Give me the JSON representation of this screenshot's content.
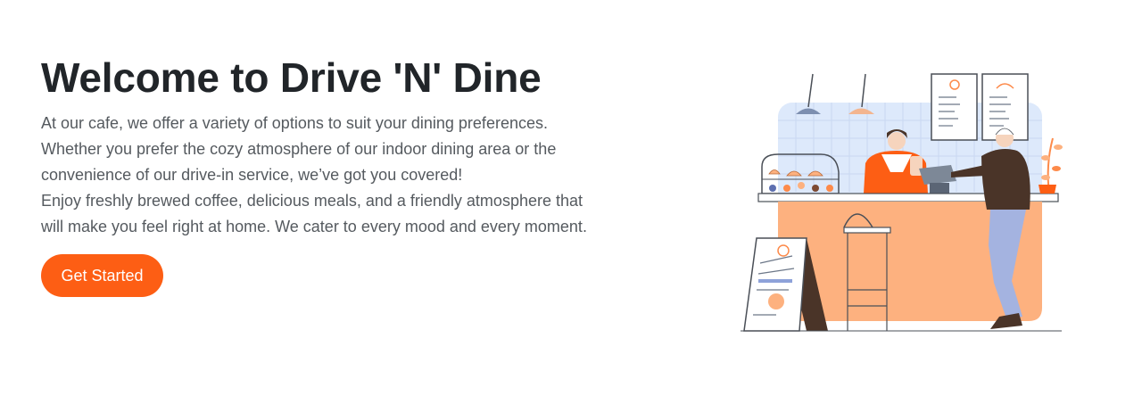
{
  "hero": {
    "title": "Welcome to Drive 'N' Dine",
    "paragraph_lines": [
      "At our cafe, we offer a variety of options to suit your dining preferences.",
      "Whether you prefer the cozy atmosphere of our indoor dining area or the",
      "convenience of our drive-in service, we’ve got you covered!",
      "Enjoy freshly brewed coffee, delicious meals, and a friendly atmosphere that",
      "will make you feel right at home. We cater to every mood and every moment."
    ],
    "cta_label": "Get Started"
  },
  "colors": {
    "accent": "#fd5e14",
    "heading": "#212529",
    "body_text": "#555a5f",
    "counter_peach": "#fdb17f",
    "wall_blue": "#dde9fb"
  },
  "illustration": {
    "icon": "cafe-counter-illustration"
  }
}
